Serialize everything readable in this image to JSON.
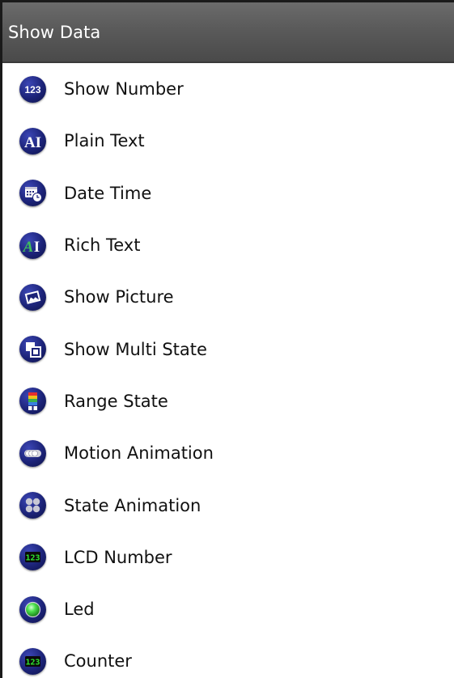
{
  "panel": {
    "title": "Show Data"
  },
  "items": [
    {
      "label": "Show Number",
      "icon": "number-123-icon"
    },
    {
      "label": "Plain Text",
      "icon": "plain-text-icon"
    },
    {
      "label": "Date Time",
      "icon": "calendar-clock-icon"
    },
    {
      "label": "Rich Text",
      "icon": "rich-text-icon"
    },
    {
      "label": "Show Picture",
      "icon": "picture-icon"
    },
    {
      "label": "Show Multi State",
      "icon": "multi-state-icon"
    },
    {
      "label": "Range State",
      "icon": "range-state-icon"
    },
    {
      "label": "Motion Animation",
      "icon": "motion-animation-icon"
    },
    {
      "label": "State Animation",
      "icon": "state-animation-icon"
    },
    {
      "label": "LCD Number",
      "icon": "lcd-number-icon"
    },
    {
      "label": "Led",
      "icon": "led-icon"
    },
    {
      "label": "Counter",
      "icon": "counter-icon"
    }
  ],
  "colors": {
    "header_bg": "#5a5a5a",
    "header_text": "#ffffff",
    "icon_bg": "#1c2378",
    "lcd_green": "#2ee62e",
    "led_green": "#3ee23e"
  },
  "icon_text": {
    "number": "123",
    "plain_text": "AI"
  }
}
